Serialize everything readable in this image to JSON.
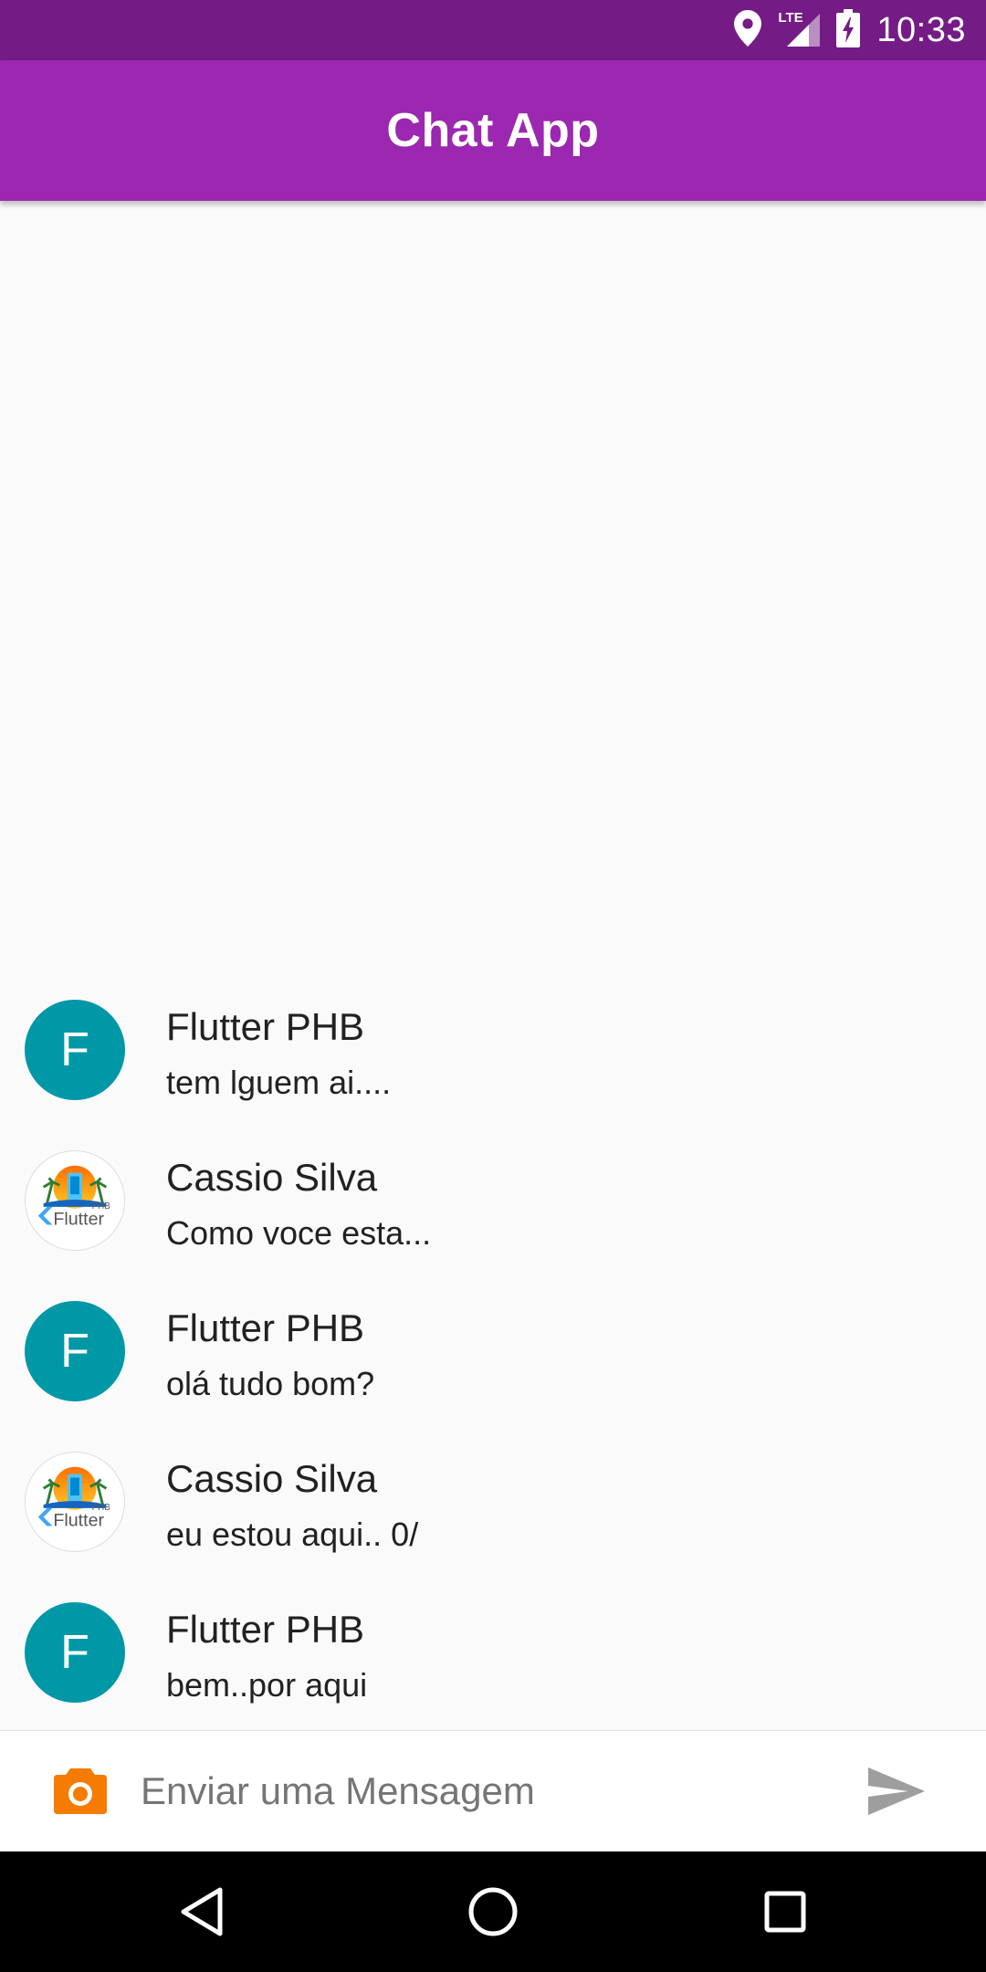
{
  "status_bar": {
    "time": "10:33",
    "network_label": "LTE",
    "icons": [
      "location-icon",
      "signal-icon",
      "battery-charging-icon"
    ]
  },
  "app_bar": {
    "title": "Chat App",
    "color": "#9c27b0"
  },
  "messages": [
    {
      "sender": "Flutter PHB",
      "text": "tem lguem ai....",
      "avatar": {
        "type": "letter",
        "letter": "F",
        "color": "#0097a7"
      }
    },
    {
      "sender": "Cassio Silva",
      "text": "Como voce esta...",
      "avatar": {
        "type": "image",
        "logo_text": "Flutter",
        "logo_sub": "PHB"
      }
    },
    {
      "sender": "Flutter PHB",
      "text": "olá tudo bom?",
      "avatar": {
        "type": "letter",
        "letter": "F",
        "color": "#0097a7"
      }
    },
    {
      "sender": "Cassio Silva",
      "text": "eu estou aqui.. 0/",
      "avatar": {
        "type": "image",
        "logo_text": "Flutter",
        "logo_sub": "PHB"
      }
    },
    {
      "sender": "Flutter PHB",
      "text": "bem..por aqui",
      "avatar": {
        "type": "letter",
        "letter": "F",
        "color": "#0097a7"
      }
    }
  ],
  "composer": {
    "placeholder": "Enviar uma Mensagem",
    "camera_icon": "camera-icon",
    "camera_color": "#f57c00",
    "send_icon": "send-icon",
    "send_color": "#9e9e9e"
  },
  "nav_bar": {
    "icons": [
      "back-icon",
      "home-icon",
      "recents-icon"
    ]
  }
}
